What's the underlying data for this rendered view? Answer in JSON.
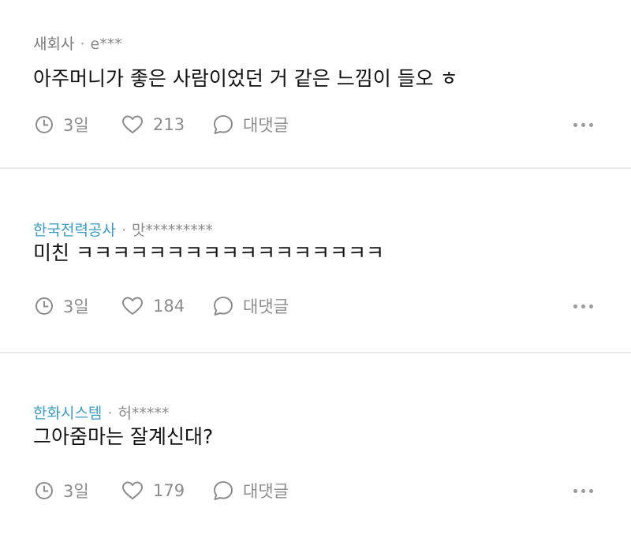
{
  "comments": [
    {
      "company": "새회사",
      "separator": "·",
      "author": "e***",
      "text": "아주머니가 좋은 사람이었던 거 같은 느낌이 들오 ㅎ",
      "time": "3일",
      "likes": "213",
      "reply_label": "댓글",
      "reply_prefix": "대"
    },
    {
      "company": "한국전력공사",
      "separator": "·",
      "author": "맛*********",
      "text": "미친 ㅋㅋㅋㅋㅋㅋㅋㅋㅋㅋㅋㅋㅋㅋㅋㅋㅋ",
      "time": "3일",
      "likes": "184",
      "reply_label": "댓글",
      "reply_prefix": "대"
    },
    {
      "company": "한화시스템",
      "separator": "·",
      "author": "허*****",
      "text": "그아줌마는 잘계신대?",
      "time": "3일",
      "likes": "179",
      "reply_label": "댓글",
      "reply_prefix": "대"
    }
  ],
  "colors": {
    "company_link": "#3a9bc4",
    "company_plain": "#7a7a7a",
    "icon": "#8c8c8c",
    "divider": "#ececec"
  },
  "icons": {
    "time": "clock-icon",
    "like": "heart-icon",
    "reply": "speech-bubble-icon",
    "more": "more-dots-icon"
  }
}
